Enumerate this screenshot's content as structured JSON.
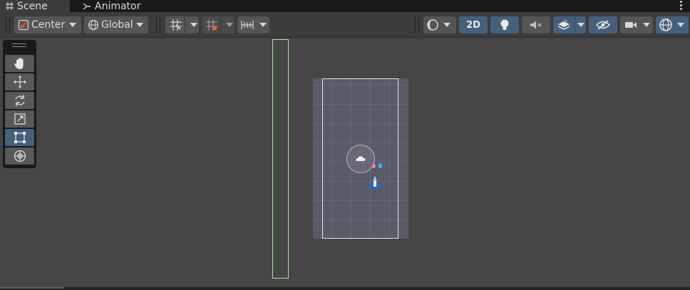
{
  "tabs": {
    "scene_label": "Scene",
    "animator_label": "Animator"
  },
  "toolbar": {
    "pivot_label": "Center",
    "space_label": "Global",
    "mode_2d_label": "2D"
  },
  "colors": {
    "accent_blue": "#46607c",
    "collider_green": "#a6e79b",
    "scene_background": "#464646"
  },
  "tools": [
    "hand-tool-icon",
    "move-tool-icon",
    "rotate-tool-icon",
    "scale-tool-icon",
    "rect-tool-icon",
    "transform-tool-icon"
  ]
}
